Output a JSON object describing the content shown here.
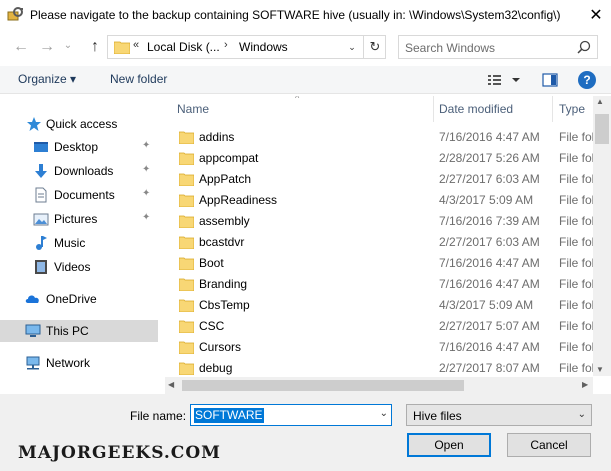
{
  "window": {
    "title": "Please navigate to the backup containing SOFTWARE hive (usually in: \\Windows\\System32\\config\\)",
    "close_glyph": "✕"
  },
  "nav": {
    "back_glyph": "←",
    "forward_glyph": "→",
    "recent_glyph": "⌄",
    "up_glyph": "↑",
    "address": {
      "prefix": "«",
      "crumbs": [
        "Local Disk (...",
        "Windows"
      ],
      "separator": "›",
      "dropdown_glyph": "⌄",
      "refresh_glyph": "↻"
    },
    "search": {
      "placeholder": "Search Windows"
    }
  },
  "toolbar": {
    "organize": "Organize ▾",
    "new_folder": "New folder",
    "help": "?"
  },
  "sidebar": {
    "items": [
      {
        "label": "Quick access",
        "icon": "star-icon",
        "pinned": false
      },
      {
        "label": "Desktop",
        "icon": "desktop-icon",
        "pinned": true
      },
      {
        "label": "Downloads",
        "icon": "download-icon",
        "pinned": true
      },
      {
        "label": "Documents",
        "icon": "document-icon",
        "pinned": true
      },
      {
        "label": "Pictures",
        "icon": "pictures-icon",
        "pinned": true
      },
      {
        "label": "Music",
        "icon": "music-icon",
        "pinned": false
      },
      {
        "label": "Videos",
        "icon": "video-icon",
        "pinned": false
      },
      {
        "label": "OneDrive",
        "icon": "cloud-icon",
        "pinned": false
      },
      {
        "label": "This PC",
        "icon": "computer-icon",
        "pinned": false,
        "selected": true
      },
      {
        "label": "Network",
        "icon": "network-icon",
        "pinned": false
      }
    ],
    "pin_glyph": "📌"
  },
  "files": {
    "columns": {
      "name": "Name",
      "date": "Date modified",
      "type": "Type"
    },
    "sort_glyph": "^",
    "rows": [
      {
        "name": "addins",
        "date": "7/16/2016 4:47 AM",
        "type": "File fol"
      },
      {
        "name": "appcompat",
        "date": "2/28/2017 5:26 AM",
        "type": "File fol"
      },
      {
        "name": "AppPatch",
        "date": "2/27/2017 6:03 AM",
        "type": "File fol"
      },
      {
        "name": "AppReadiness",
        "date": "4/3/2017 5:09 AM",
        "type": "File fol"
      },
      {
        "name": "assembly",
        "date": "7/16/2016 7:39 AM",
        "type": "File fol"
      },
      {
        "name": "bcastdvr",
        "date": "2/27/2017 6:03 AM",
        "type": "File fol"
      },
      {
        "name": "Boot",
        "date": "7/16/2016 4:47 AM",
        "type": "File fol"
      },
      {
        "name": "Branding",
        "date": "7/16/2016 4:47 AM",
        "type": "File fol"
      },
      {
        "name": "CbsTemp",
        "date": "4/3/2017 5:09 AM",
        "type": "File fol"
      },
      {
        "name": "CSC",
        "date": "2/27/2017 5:07 AM",
        "type": "File fol"
      },
      {
        "name": "Cursors",
        "date": "7/16/2016 4:47 AM",
        "type": "File fol"
      },
      {
        "name": "debug",
        "date": "2/27/2017 8:07 AM",
        "type": "File fol"
      }
    ]
  },
  "bottom": {
    "filename_label": "File name:",
    "filename_value": "SOFTWARE",
    "filter_value": "Hive files",
    "dropdown_glyph": "⌄",
    "open_label": "Open",
    "cancel_label": "Cancel",
    "watermark": "MAJORGEEKS.COM"
  },
  "colors": {
    "accent": "#0078d7",
    "folder": "#f8d775",
    "selected_bg": "#d9d9d9",
    "toolbar_bg": "#f5f6f7"
  }
}
